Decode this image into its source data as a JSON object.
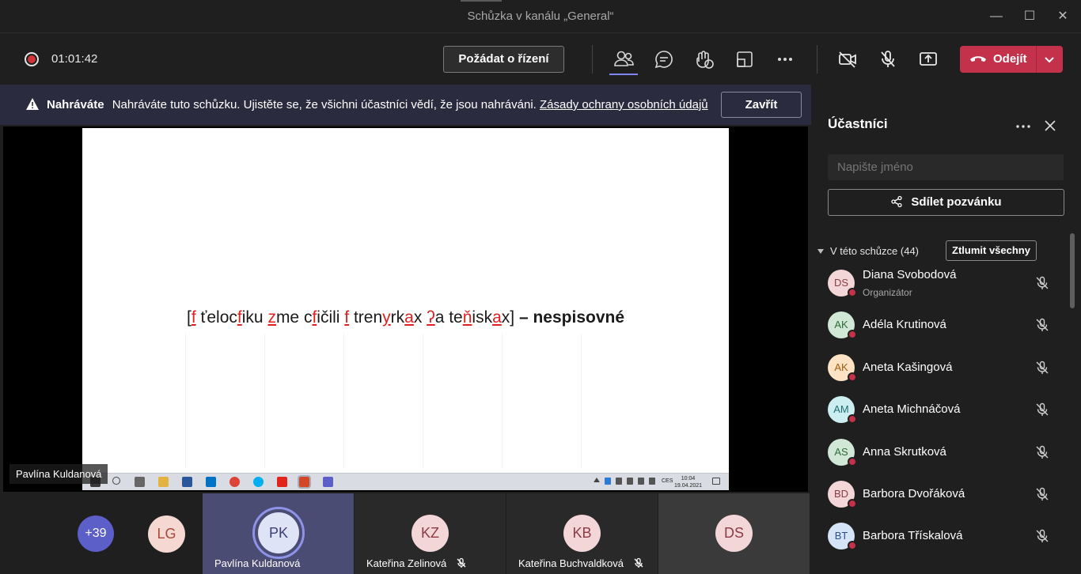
{
  "window": {
    "title": "Schůzka v kanálu „General“",
    "minimize": "—",
    "maximize": "☐",
    "close": "✕"
  },
  "toolbar": {
    "timer": "01:01:42",
    "request_control": "Požádat o řízení",
    "leave_label": "Odejít"
  },
  "banner": {
    "bold": "Nahráváte",
    "text": "Nahráváte tuto schůzku. Ujistěte se, že všichni účastníci vědí, že jsou nahráváni.",
    "link": "Zásady ochrany osobních údajů",
    "close": "Zavřít"
  },
  "slide": {
    "t1": "[",
    "t2": "f",
    "t3": " ťeloc",
    "t4": "f",
    "t5": "iku ",
    "t6": "z",
    "t7": "me c",
    "t8": "f",
    "t9": "ičili ",
    "t10": "f",
    "t11": " tren",
    "t12": "y",
    "t13": "rk",
    "t14": "a",
    "t15": "x ",
    "t16": "ʔ",
    "t17": "a te",
    "t18": "ň",
    "t19": "isk",
    "t20": "a",
    "t21": "x] ",
    "bold": "– nespisovné"
  },
  "taskbar": {
    "lang": "CES",
    "time": "10:04",
    "date": "19.04.2021"
  },
  "stage": {
    "presenter_name": "Pavlína Kuldanová"
  },
  "thumbnails": {
    "more": "+39",
    "lg": "LG",
    "pk_initials": "PK",
    "pk_name": "Pavlína Kuldanová",
    "kz_initials": "KZ",
    "kz_name": "Kateřina Zelinová",
    "kb_initials": "KB",
    "kb_name": "Kateřina Buchvaldková",
    "ds": "DS"
  },
  "panel": {
    "title": "Účastníci",
    "search_placeholder": "Napište jméno",
    "share": "Sdílet pozvánku",
    "section": "V této schůzce (44)",
    "mute_all": "Ztlumit všechny",
    "participants": [
      {
        "initials": "DS",
        "name": "Diana Svobodová",
        "role": "Organizátor",
        "bg": "#f3d6d8",
        "fg": "#8a3b46"
      },
      {
        "initials": "AK",
        "name": "Adéla Krutinová",
        "role": "",
        "bg": "#d2e8d6",
        "fg": "#2f6b3b"
      },
      {
        "initials": "AK",
        "name": "Aneta Kašingová",
        "role": "",
        "bg": "#fde3c4",
        "fg": "#a05a12"
      },
      {
        "initials": "AM",
        "name": "Aneta Michnáčová",
        "role": "",
        "bg": "#cdeef0",
        "fg": "#1f6e74"
      },
      {
        "initials": "AS",
        "name": "Anna Skrutková",
        "role": "",
        "bg": "#d2e8d6",
        "fg": "#2f6b3b"
      },
      {
        "initials": "BD",
        "name": "Barbora Dvořáková",
        "role": "",
        "bg": "#f3d6d8",
        "fg": "#8a3b46"
      },
      {
        "initials": "BT",
        "name": "Barbora Třískalová",
        "role": "",
        "bg": "#d6e4f7",
        "fg": "#2c4f86"
      }
    ]
  }
}
